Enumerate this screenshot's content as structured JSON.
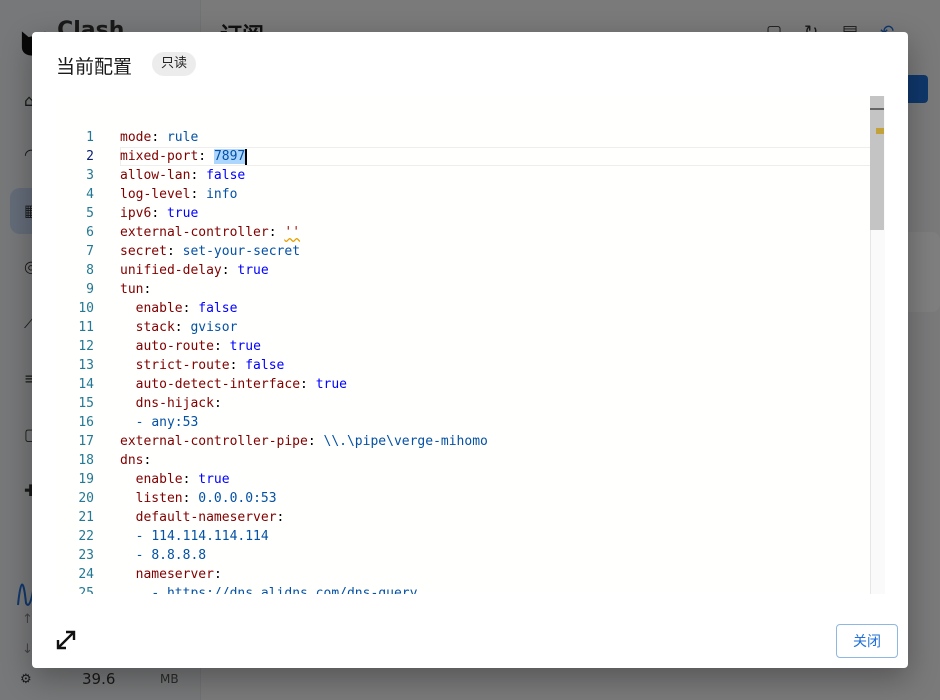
{
  "app": {
    "name": "Clash Verge",
    "page_title": "订阅",
    "memory": {
      "value": "39.6",
      "unit": "MB"
    }
  },
  "dialog": {
    "title": "当前配置",
    "readonly_label": "只读",
    "close_label": "关闭",
    "expand_icon": "expand-icon"
  },
  "editor": {
    "current_line": 2,
    "lines": [
      {
        "n": "1",
        "indent": "",
        "key": "mode",
        "sep": ": ",
        "val": "rule",
        "vtype": "s"
      },
      {
        "n": "2",
        "indent": "",
        "key": "mixed-port",
        "sep": ": ",
        "val": "7897",
        "vtype": "hl"
      },
      {
        "n": "3",
        "indent": "",
        "key": "allow-lan",
        "sep": ": ",
        "val": "false",
        "vtype": "b"
      },
      {
        "n": "4",
        "indent": "",
        "key": "log-level",
        "sep": ": ",
        "val": "info",
        "vtype": "s"
      },
      {
        "n": "5",
        "indent": "",
        "key": "ipv6",
        "sep": ": ",
        "val": "true",
        "vtype": "b"
      },
      {
        "n": "6",
        "indent": "",
        "key": "external-controller",
        "sep": ": ",
        "val": "''",
        "vtype": "sq"
      },
      {
        "n": "7",
        "indent": "",
        "key": "secret",
        "sep": ": ",
        "val": "set-your-secret",
        "vtype": "s"
      },
      {
        "n": "8",
        "indent": "",
        "key": "unified-delay",
        "sep": ": ",
        "val": "true",
        "vtype": "b"
      },
      {
        "n": "9",
        "indent": "",
        "key": "tun",
        "sep": ":",
        "val": "",
        "vtype": "s"
      },
      {
        "n": "10",
        "indent": "  ",
        "key": "enable",
        "sep": ": ",
        "val": "false",
        "vtype": "b"
      },
      {
        "n": "11",
        "indent": "  ",
        "key": "stack",
        "sep": ": ",
        "val": "gvisor",
        "vtype": "s"
      },
      {
        "n": "12",
        "indent": "  ",
        "key": "auto-route",
        "sep": ": ",
        "val": "true",
        "vtype": "b"
      },
      {
        "n": "13",
        "indent": "  ",
        "key": "strict-route",
        "sep": ": ",
        "val": "false",
        "vtype": "b"
      },
      {
        "n": "14",
        "indent": "  ",
        "key": "auto-detect-interface",
        "sep": ": ",
        "val": "true",
        "vtype": "b"
      },
      {
        "n": "15",
        "indent": "  ",
        "key": "dns-hijack",
        "sep": ":",
        "val": "",
        "vtype": "s"
      },
      {
        "n": "16",
        "indent": "  ",
        "key": "",
        "sep": "- ",
        "val": "any:53",
        "vtype": "s"
      },
      {
        "n": "17",
        "indent": "",
        "key": "external-controller-pipe",
        "sep": ": ",
        "val": "\\\\.\\pipe\\verge-mihomo",
        "vtype": "s"
      },
      {
        "n": "18",
        "indent": "",
        "key": "dns",
        "sep": ":",
        "val": "",
        "vtype": "s"
      },
      {
        "n": "19",
        "indent": "  ",
        "key": "enable",
        "sep": ": ",
        "val": "true",
        "vtype": "b"
      },
      {
        "n": "20",
        "indent": "  ",
        "key": "listen",
        "sep": ": ",
        "val": "0.0.0.0:53",
        "vtype": "s"
      },
      {
        "n": "21",
        "indent": "  ",
        "key": "default-nameserver",
        "sep": ":",
        "val": "",
        "vtype": "s"
      },
      {
        "n": "22",
        "indent": "  ",
        "key": "",
        "sep": "- ",
        "val": "114.114.114.114",
        "vtype": "s"
      },
      {
        "n": "23",
        "indent": "  ",
        "key": "",
        "sep": "- ",
        "val": "8.8.8.8",
        "vtype": "s"
      },
      {
        "n": "24",
        "indent": "  ",
        "key": "nameserver",
        "sep": ":",
        "val": "",
        "vtype": "s"
      },
      {
        "n": "25",
        "indent": "    ",
        "key": "",
        "sep": "- ",
        "val": "https://dns.alidns.com/dns-query",
        "vtype": "s"
      }
    ]
  }
}
